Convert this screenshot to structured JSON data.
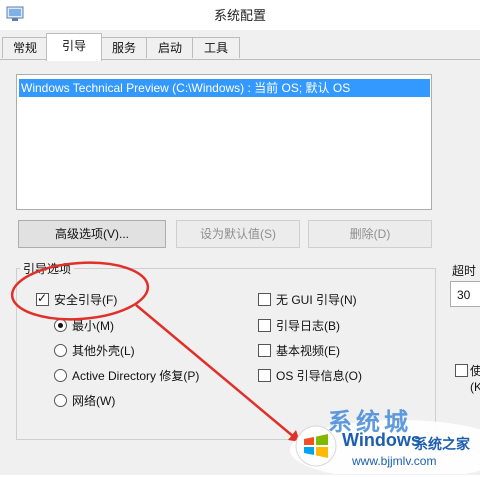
{
  "window": {
    "title": "系统配置"
  },
  "tabs": [
    {
      "label": "常规",
      "active": false
    },
    {
      "label": "引导",
      "active": true
    },
    {
      "label": "服务",
      "active": false
    },
    {
      "label": "启动",
      "active": false
    },
    {
      "label": "工具",
      "active": false
    }
  ],
  "boot_list": {
    "items": [
      "Windows Technical Preview (C:\\Windows) : 当前 OS; 默认 OS"
    ]
  },
  "buttons": {
    "advanced": "高级选项(V)...",
    "set_default": "设为默认值(S)",
    "delete": "删除(D)"
  },
  "boot_options": {
    "legend": "引导选项",
    "safe_boot": {
      "label": "安全引导(F)",
      "checked": true
    },
    "radios": [
      {
        "label": "最小(M)",
        "checked": true
      },
      {
        "label": "其他外壳(L)",
        "checked": false
      },
      {
        "label": "Active Directory 修复(P)",
        "checked": false
      },
      {
        "label": "网络(W)",
        "checked": false
      }
    ],
    "right_checks": [
      {
        "label": "无 GUI 引导(N)",
        "checked": false
      },
      {
        "label": "引导日志(B)",
        "checked": false
      },
      {
        "label": "基本视频(E)",
        "checked": false
      },
      {
        "label": "OS 引导信息(O)",
        "checked": false
      }
    ]
  },
  "timeout": {
    "label": "超时",
    "value": "30"
  },
  "side_option": {
    "label": "使",
    "sub": "(K"
  },
  "watermark": {
    "brand": "系统城",
    "windows": "Windows",
    "cn": "系统之家",
    "url": "www.bjjmlv.com"
  },
  "colors": {
    "selection": "#3399ff",
    "annotation": "#e0302a",
    "watermark": "#1d5fae"
  }
}
